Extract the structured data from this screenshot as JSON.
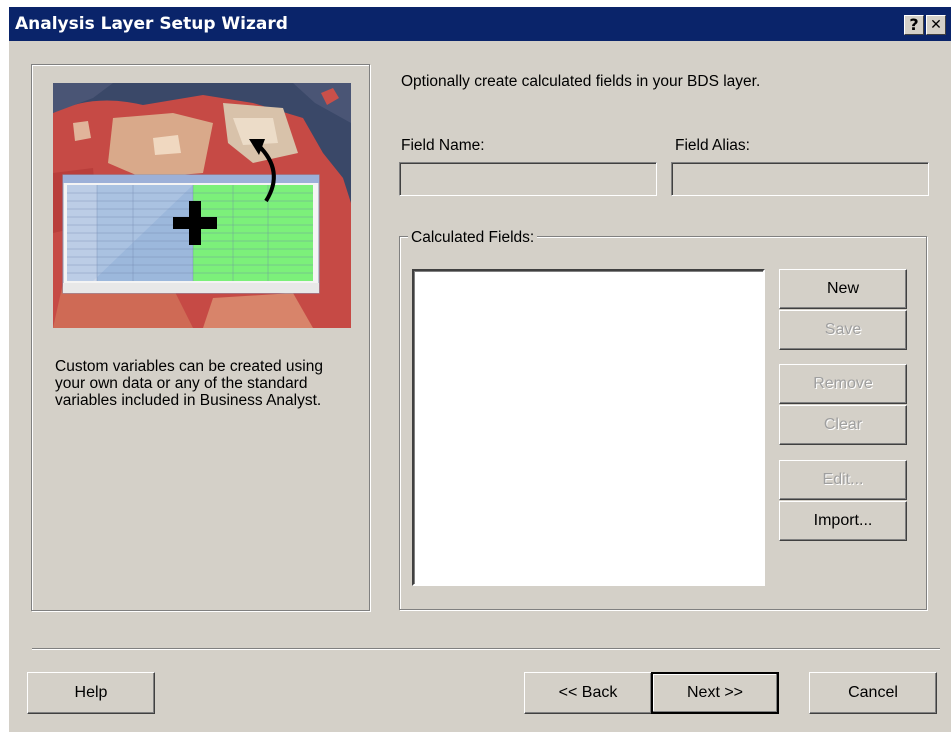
{
  "window": {
    "title": "Analysis Layer Setup Wizard",
    "help_glyph": "?",
    "close_glyph": "✕"
  },
  "left_panel": {
    "description": "Custom variables can be created using your own data or any of the standard variables included in Business Analyst."
  },
  "main": {
    "instruction": "Optionally create calculated fields in your BDS layer.",
    "field_name_label": "Field Name:",
    "field_name_value": "",
    "field_alias_label": "Field Alias:",
    "field_alias_value": "",
    "calculated_fields_label": "Calculated Fields:",
    "calculated_fields_items": [],
    "buttons": {
      "new": "New",
      "save": "Save",
      "remove": "Remove",
      "clear": "Clear",
      "edit": "Edit...",
      "import": "Import..."
    }
  },
  "footer": {
    "help": "Help",
    "back": "<< Back",
    "next": "Next >>",
    "cancel": "Cancel"
  },
  "colors": {
    "titlebar": "#0a246a",
    "face": "#d4d0c8",
    "disabled_text": "#a0a0a0"
  }
}
